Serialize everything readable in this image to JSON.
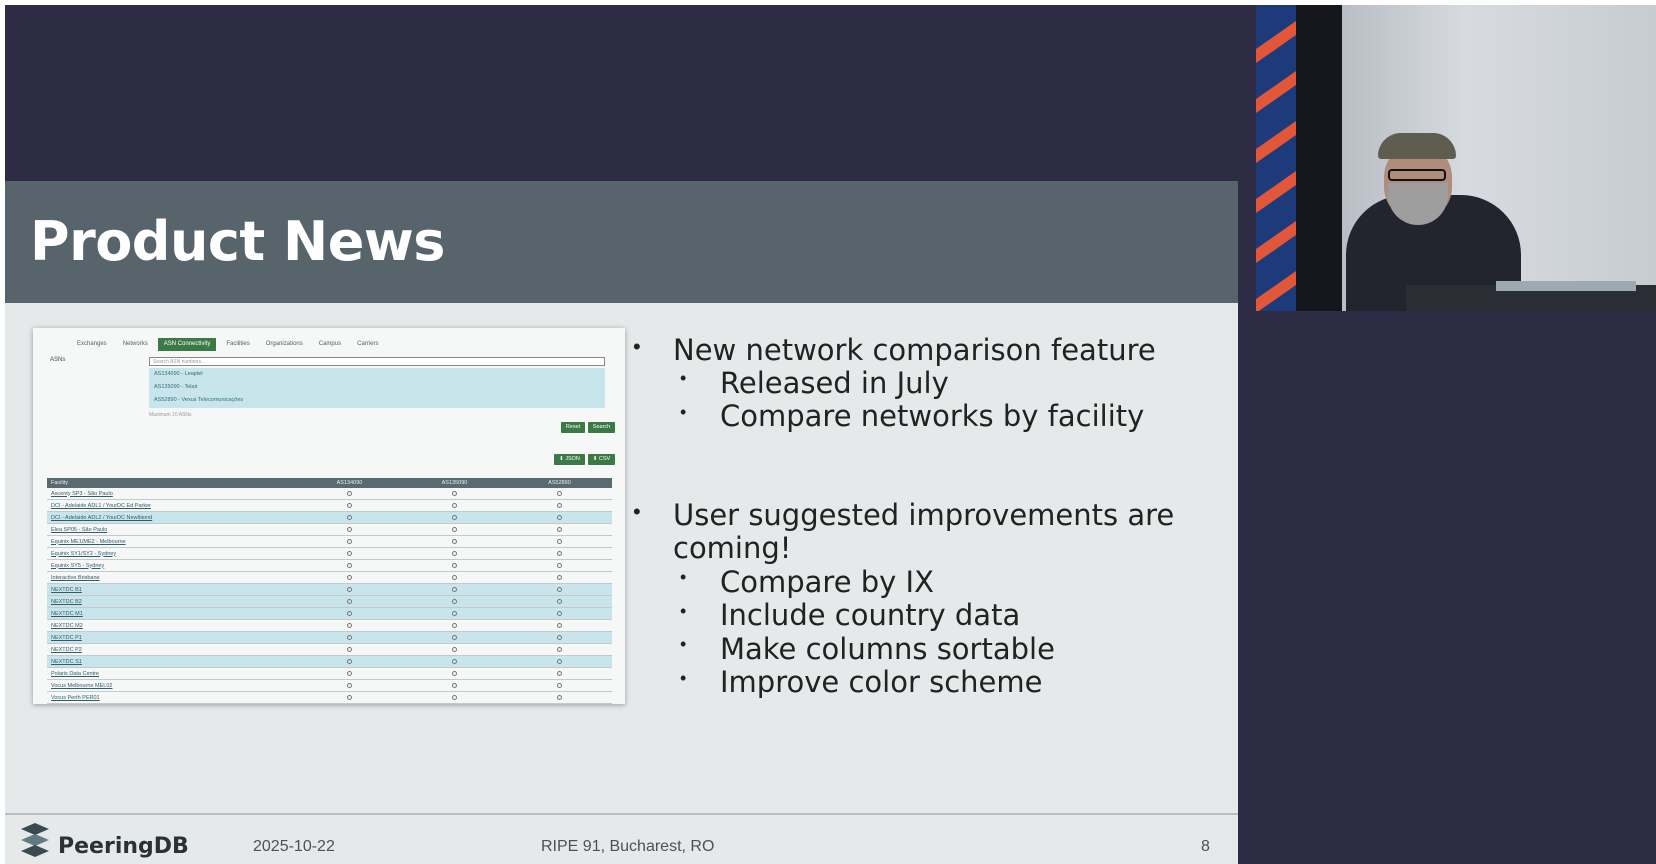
{
  "slide": {
    "title": "Product News",
    "bullets": [
      {
        "level": 1,
        "text": "New network comparison feature"
      },
      {
        "level": 2,
        "text": "Released in July"
      },
      {
        "level": 2,
        "text": "Compare networks by facility"
      },
      {
        "level": 1,
        "text": "User suggested improvements are"
      },
      {
        "level": 1,
        "text": "coming!",
        "continuation": true
      },
      {
        "level": 2,
        "text": "Compare by IX"
      },
      {
        "level": 2,
        "text": "Include country data"
      },
      {
        "level": 2,
        "text": "Make columns sortable"
      },
      {
        "level": 2,
        "text": "Improve color scheme"
      }
    ],
    "footer": {
      "logo_text": "PeeringDB",
      "date": "2025-10-22",
      "event": "RIPE 91, Bucharest, RO",
      "page": "8"
    }
  },
  "screenshot": {
    "tabs": [
      "Exchanges",
      "Networks",
      "ASN Connectivity",
      "Facilities",
      "Organizations",
      "Campus",
      "Carriers"
    ],
    "active_tab": "ASN Connectivity",
    "asns_label": "ASNs",
    "search_placeholder": "Search ASN numbers...",
    "suggestions": [
      "AS134090 - Leaptel",
      "AS135090 - Telair",
      "AS52890 - Vexus Telecomunicações"
    ],
    "max_note": "Maximum 10 ASNs",
    "buttons": {
      "reset": "Reset",
      "search": "Search",
      "json": "⬇ JSON",
      "csv": "⬇ CSV"
    },
    "table": {
      "headers": [
        "Facility",
        "AS134090",
        "AS135090",
        "AS52890"
      ],
      "rows": [
        {
          "name": "Ascenty SP3 - São Paulo",
          "hl": false
        },
        {
          "name": "DCI - Adelaide ADL1 / YourDC Ed Parker",
          "hl": false
        },
        {
          "name": "DCI - Adelaide ADL2 / YourDC Newlbiond",
          "hl": true
        },
        {
          "name": "Elea SP05 - São Paulo",
          "hl": false
        },
        {
          "name": "Equinix ME1/ME2 - Melbourne",
          "hl": false
        },
        {
          "name": "Equinix SY1/SY2 - Sydney",
          "hl": false
        },
        {
          "name": "Equinix SY5 - Sydney",
          "hl": false
        },
        {
          "name": "Interactive Brisbane",
          "hl": false
        },
        {
          "name": "NEXTDC B1",
          "hl": true
        },
        {
          "name": "NEXTDC B2",
          "hl": true
        },
        {
          "name": "NEXTDC M1",
          "hl": true
        },
        {
          "name": "NEXTDC M2",
          "hl": false
        },
        {
          "name": "NEXTDC P1",
          "hl": true
        },
        {
          "name": "NEXTDC P2",
          "hl": false
        },
        {
          "name": "NEXTDC S1",
          "hl": true
        },
        {
          "name": "Polaris Data Centre",
          "hl": false
        },
        {
          "name": "Vocus Melbourne MEL02",
          "hl": false
        },
        {
          "name": "Vocus Perth PER01",
          "hl": false
        }
      ]
    }
  },
  "colors": {
    "slide_background": "#2e2c44",
    "title_band": "#58646c",
    "content_background": "#e6e9ea",
    "accent_green": "#3c7a45",
    "highlight_row": "#c9e5ec"
  },
  "icons": {
    "logo": "peeringdb-logo-icon",
    "cell": "circle-indicator-icon"
  }
}
